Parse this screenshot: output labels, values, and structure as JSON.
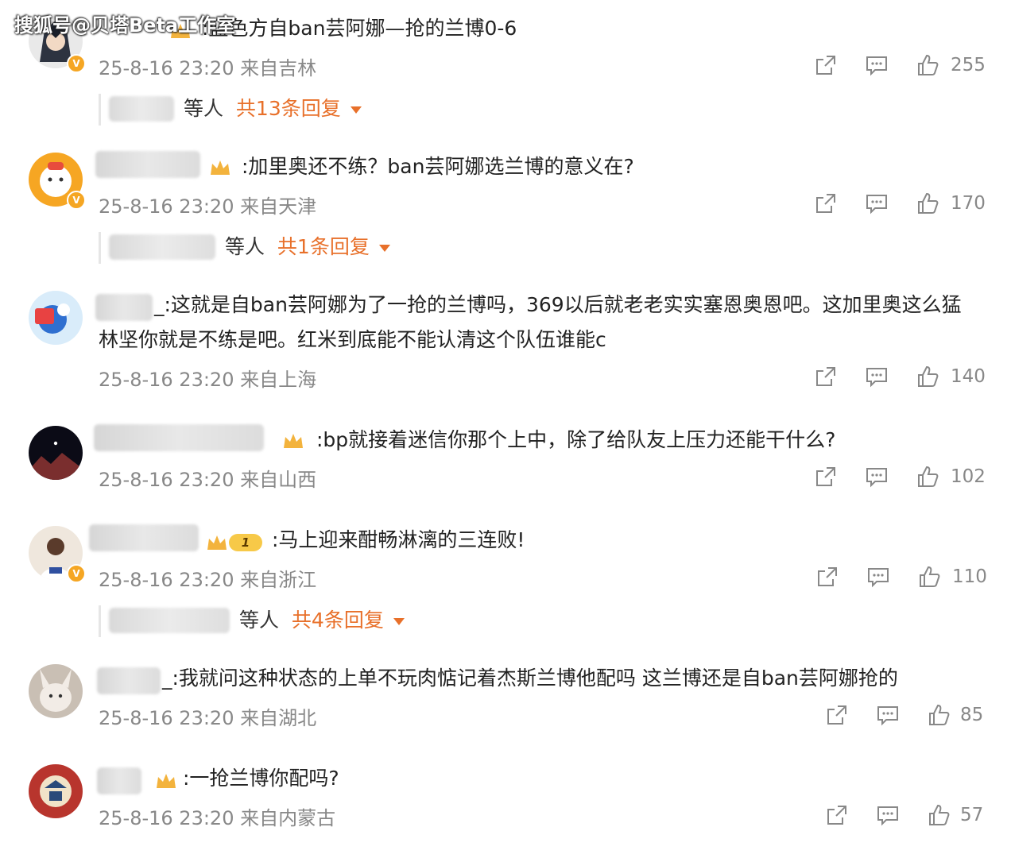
{
  "watermark": "搜狐号@贝塔Beta工作室",
  "colors": {
    "reply_accent": "#e8702a",
    "meta_gray": "#888888",
    "badge_orange": "#f5a623"
  },
  "comments": [
    {
      "text": ":蓝色方自ban芸阿娜—抢的兰博0-6",
      "time": "25-8-16 23:20",
      "location": "来自吉林",
      "likes": "255",
      "verified": true,
      "replies": {
        "suffix": "等人",
        "count": "共13条回复"
      }
    },
    {
      "text": ":加里奥还不练？ban芸阿娜选兰博的意义在?",
      "time": "25-8-16 23:20",
      "location": "来自天津",
      "likes": "170",
      "verified": true,
      "replies": {
        "suffix": "等人",
        "count": "共1条回复"
      }
    },
    {
      "text": "_:这就是自ban芸阿娜为了一抢的兰博吗，369以后就老老实实塞恩奥恩吧。这加里奥这么猛林坚你就是不练是吧。红米到底能不能认清这个队伍谁能c",
      "time": "25-8-16 23:20",
      "location": "来自上海",
      "likes": "140",
      "verified": false
    },
    {
      "text": ":bp就接着迷信你那个上中，除了给队友上压力还能干什么?",
      "time": "25-8-16 23:20",
      "location": "来自山西",
      "likes": "102",
      "verified": false
    },
    {
      "text": ":马上迎来酣畅淋漓的三连败!",
      "time": "25-8-16 23:20",
      "location": "来自浙江",
      "likes": "110",
      "verified": true,
      "badge_level": "1",
      "replies": {
        "suffix": "等人",
        "count": "共4条回复"
      }
    },
    {
      "text": "_:我就问这种状态的上单不玩肉惦记着杰斯兰博他配吗 这兰博还是自ban芸阿娜抢的",
      "time": "25-8-16 23:20",
      "location": "来自湖北",
      "likes": "85",
      "verified": false
    },
    {
      "text": ":一抢兰博你配吗?",
      "time": "25-8-16 23:20",
      "location": "来自内蒙古",
      "likes": "57",
      "verified": false
    }
  ]
}
